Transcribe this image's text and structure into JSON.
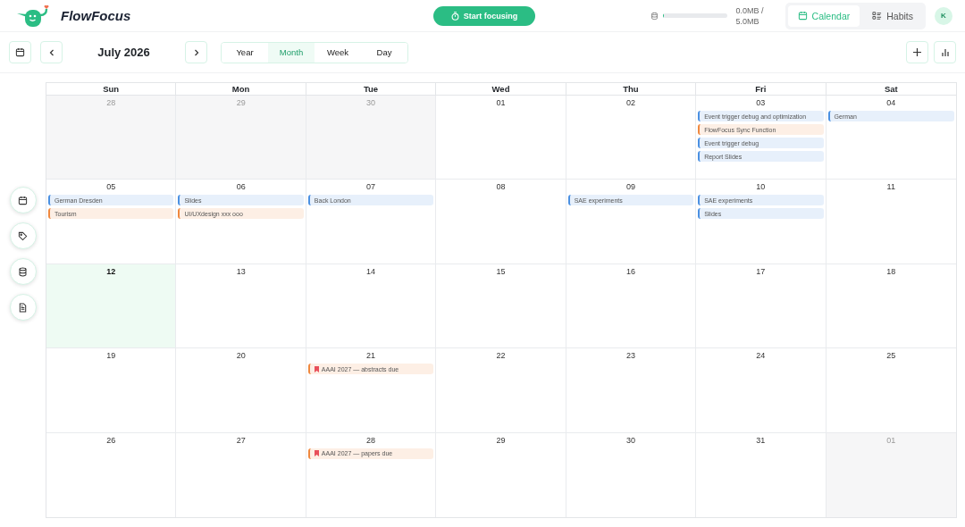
{
  "app": {
    "name": "FlowFocus",
    "focus_button": "Start focusing",
    "storage": {
      "level": 0.02,
      "line_1": "0.0MB /",
      "line_2": "5.0MB"
    },
    "views": [
      {
        "label": "Calendar",
        "kind": "calendar",
        "selected": true
      },
      {
        "label": "Habits",
        "kind": "habits",
        "selected": false
      }
    ],
    "avatar": "K"
  },
  "toolbar": {
    "title": "July 2026",
    "ranges": [
      {
        "label": "Year",
        "selected": false
      },
      {
        "label": "Month",
        "selected": true
      },
      {
        "label": "Week",
        "selected": false
      },
      {
        "label": "Day",
        "selected": false
      }
    ]
  },
  "side_tools": [
    {
      "kind": "calendar"
    },
    {
      "kind": "tag"
    },
    {
      "kind": "database"
    },
    {
      "kind": "document"
    }
  ],
  "calendar": {
    "weekdays": [
      "Sun",
      "Mon",
      "Tue",
      "Wed",
      "Thu",
      "Fri",
      "Sat"
    ],
    "weeks": [
      [
        {
          "day": "28",
          "outside": true,
          "today": false
        },
        {
          "day": "29",
          "outside": true,
          "today": false
        },
        {
          "day": "30",
          "outside": true,
          "today": false
        },
        {
          "day": "01",
          "outside": false,
          "today": false
        },
        {
          "day": "02",
          "outside": false,
          "today": false
        },
        {
          "day": "03",
          "outside": false,
          "today": false,
          "events": [
            {
              "title": "Event trigger debug and optimization",
              "color": "#4a90e2",
              "kind": "task"
            },
            {
              "title": "FlowFocus Sync Function",
              "color": "#f0883e",
              "kind": "task"
            },
            {
              "title": "Event trigger debug",
              "color": "#4a90e2",
              "kind": "task"
            },
            {
              "title": "Report Slides",
              "color": "#4a90e2",
              "kind": "task"
            }
          ]
        },
        {
          "day": "04",
          "outside": false,
          "today": false,
          "events": [
            {
              "title": "German",
              "color": "#4a90e2",
              "kind": "task"
            }
          ]
        }
      ],
      [
        {
          "day": "05",
          "outside": false,
          "today": false,
          "events": [
            {
              "title": "German Dresden",
              "color": "#4a90e2",
              "kind": "task"
            },
            {
              "title": "Tourism",
              "color": "#f0883e",
              "kind": "task"
            }
          ]
        },
        {
          "day": "06",
          "outside": false,
          "today": false,
          "events": [
            {
              "title": "Slides",
              "color": "#4a90e2",
              "kind": "task"
            },
            {
              "title": "UI/UXdesign xxx ooo",
              "color": "#f0883e",
              "kind": "task"
            }
          ]
        },
        {
          "day": "07",
          "outside": false,
          "today": false,
          "events": [
            {
              "title": "Back London",
              "color": "#4a90e2",
              "kind": "task"
            }
          ]
        },
        {
          "day": "08",
          "outside": false,
          "today": false
        },
        {
          "day": "09",
          "outside": false,
          "today": false,
          "events": [
            {
              "title": "SAE experiments",
              "color": "#4a90e2",
              "kind": "task"
            }
          ]
        },
        {
          "day": "10",
          "outside": false,
          "today": false,
          "events": [
            {
              "title": "SAE experiments",
              "color": "#4a90e2",
              "kind": "task"
            },
            {
              "title": "Slides",
              "color": "#4a90e2",
              "kind": "task"
            }
          ]
        },
        {
          "day": "11",
          "outside": false,
          "today": false
        }
      ],
      [
        {
          "day": "12",
          "outside": false,
          "today": true
        },
        {
          "day": "13",
          "outside": false,
          "today": false
        },
        {
          "day": "14",
          "outside": false,
          "today": false
        },
        {
          "day": "15",
          "outside": false,
          "today": false
        },
        {
          "day": "16",
          "outside": false,
          "today": false
        },
        {
          "day": "17",
          "outside": false,
          "today": false
        },
        {
          "day": "18",
          "outside": false,
          "today": false
        }
      ],
      [
        {
          "day": "19",
          "outside": false,
          "today": false
        },
        {
          "day": "20",
          "outside": false,
          "today": false
        },
        {
          "day": "21",
          "outside": false,
          "today": false,
          "events": [
            {
              "title": "AAAI 2027 — abstracts due",
              "color": "#f0883e",
              "kind": "deadline"
            }
          ]
        },
        {
          "day": "22",
          "outside": false,
          "today": false
        },
        {
          "day": "23",
          "outside": false,
          "today": false
        },
        {
          "day": "24",
          "outside": false,
          "today": false
        },
        {
          "day": "25",
          "outside": false,
          "today": false
        }
      ],
      [
        {
          "day": "26",
          "outside": false,
          "today": false
        },
        {
          "day": "27",
          "outside": false,
          "today": false
        },
        {
          "day": "28",
          "outside": false,
          "today": false,
          "events": [
            {
              "title": "AAAI 2027 — papers due",
              "color": "#f0883e",
              "kind": "deadline"
            }
          ]
        },
        {
          "day": "29",
          "outside": false,
          "today": false
        },
        {
          "day": "30",
          "outside": false,
          "today": false
        },
        {
          "day": "31",
          "outside": false,
          "today": false
        },
        {
          "day": "01",
          "outside": true,
          "today": false
        }
      ]
    ]
  }
}
